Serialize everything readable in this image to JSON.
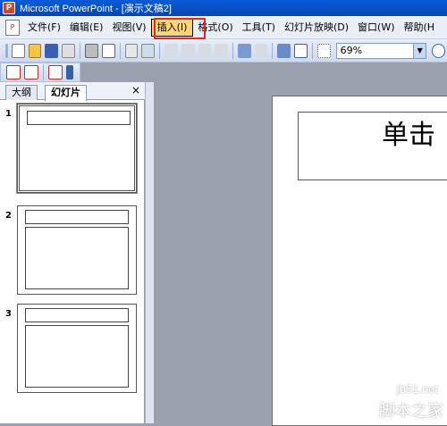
{
  "window": {
    "title": "Microsoft PowerPoint - [演示文稿2]"
  },
  "menu": {
    "items": [
      {
        "label": "文件(F)"
      },
      {
        "label": "编辑(E)"
      },
      {
        "label": "视图(V)"
      },
      {
        "label": "插入(I)"
      },
      {
        "label": "格式(O)"
      },
      {
        "label": "工具(T)"
      },
      {
        "label": "幻灯片放映(D)"
      },
      {
        "label": "窗口(W)"
      },
      {
        "label": "帮助(H"
      }
    ],
    "active": "插入(I)"
  },
  "toolbar": {
    "zoom_value": "69%"
  },
  "panel": {
    "tabs": [
      {
        "label": "大纲"
      },
      {
        "label": "幻灯片"
      }
    ],
    "selected_tab": "幻灯片",
    "close_glyph": "×",
    "slides": [
      {
        "number": "1"
      },
      {
        "number": "2"
      },
      {
        "number": "3"
      }
    ]
  },
  "slide": {
    "title_text": "单击"
  },
  "watermark": {
    "line1": "jb51.net",
    "line2": "脚本之家"
  }
}
